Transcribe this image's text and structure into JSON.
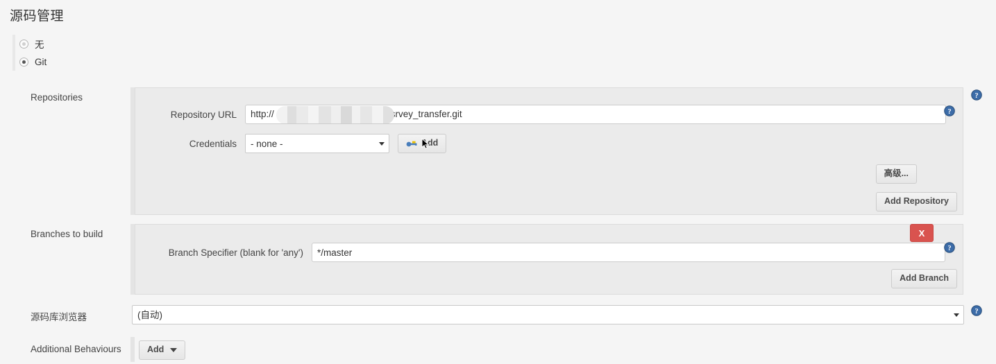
{
  "page": {
    "title": "源码管理"
  },
  "scm_radio": {
    "options": [
      {
        "label": "无",
        "selected": false
      },
      {
        "label": "Git",
        "selected": true
      }
    ]
  },
  "repositories": {
    "label": "Repositories",
    "repository_url": {
      "label": "Repository URL",
      "value_prefix": "http://",
      "value_suffix": "srvey_transfer.git",
      "redacted": true
    },
    "credentials": {
      "label": "Credentials",
      "selected": "- none -",
      "options": [
        "- none -"
      ],
      "add_button": "Add",
      "add_icon": "key-icon"
    },
    "advanced_button": "高级...",
    "add_repository_button": "Add Repository"
  },
  "branches": {
    "label": "Branches to build",
    "branch_specifier": {
      "label": "Branch Specifier (blank for 'any')",
      "value": "*/master"
    },
    "delete_button": "X",
    "add_branch_button": "Add Branch"
  },
  "repo_browser": {
    "label": "源码库浏览器",
    "selected": "(自动)",
    "options": [
      "(自动)"
    ]
  },
  "additional_behaviours": {
    "label": "Additional Behaviours",
    "add_button": "Add"
  },
  "icons": {
    "help": "help-icon",
    "chevron_down": "chevron-down-icon"
  },
  "colors": {
    "page_bg": "#f5f5f5",
    "panel_bg": "#ebebeb",
    "tab_bar": "#e4e4e4",
    "help_blue": "#2f5f9e",
    "danger_red": "#d9534f",
    "text": "#333333"
  }
}
